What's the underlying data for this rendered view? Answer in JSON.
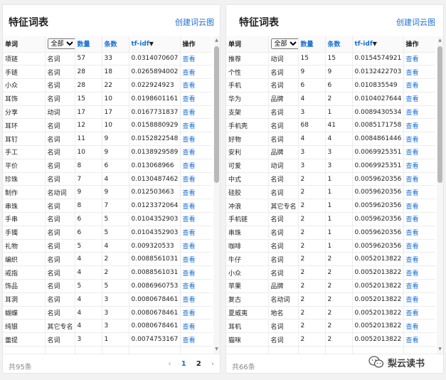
{
  "left_panel": {
    "title": "特征词表",
    "create_link": "创建词云图",
    "headers": {
      "word": "单词",
      "pos_filter": "全部",
      "count": "数量",
      "num": "条数",
      "tfidf": "tf-idf",
      "op": "操作"
    },
    "pos_options": [
      "全部"
    ],
    "rows": [
      [
        "项链",
        "名词",
        "57",
        "33",
        "0.0314070607",
        "查看"
      ],
      [
        "手链",
        "名词",
        "28",
        "18",
        "0.0265894002",
        "查看"
      ],
      [
        "小众",
        "名词",
        "28",
        "22",
        "0.022924923",
        "查看"
      ],
      [
        "耳饰",
        "名词",
        "15",
        "10",
        "0.0198601161",
        "查看"
      ],
      [
        "分享",
        "动词",
        "17",
        "17",
        "0.0167731837",
        "查看"
      ],
      [
        "耳环",
        "名词",
        "12",
        "10",
        "0.0158880929",
        "查看"
      ],
      [
        "耳钉",
        "名词",
        "11",
        "9",
        "0.0152822548",
        "查看"
      ],
      [
        "手工",
        "名词",
        "10",
        "9",
        "0.0138929589",
        "查看"
      ],
      [
        "平价",
        "名词",
        "8",
        "6",
        "0.013068966",
        "查看"
      ],
      [
        "珍珠",
        "名词",
        "7",
        "4",
        "0.0130487462",
        "查看"
      ],
      [
        "制作",
        "名动词",
        "9",
        "9",
        "0.012503663",
        "查看"
      ],
      [
        "串珠",
        "名词",
        "8",
        "7",
        "0.0123372064",
        "查看"
      ],
      [
        "手串",
        "名词",
        "6",
        "5",
        "0.0104352903",
        "查看"
      ],
      [
        "手镯",
        "名词",
        "6",
        "5",
        "0.0104352903",
        "查看"
      ],
      [
        "礼物",
        "名词",
        "5",
        "4",
        "0.009320533",
        "查看"
      ],
      [
        "编织",
        "名词",
        "4",
        "2",
        "0.0088561031",
        "查看"
      ],
      [
        "戒指",
        "名词",
        "4",
        "2",
        "0.0088561031",
        "查看"
      ],
      [
        "饰品",
        "名词",
        "5",
        "5",
        "0.0086960753",
        "查看"
      ],
      [
        "耳洞",
        "名词",
        "4",
        "3",
        "0.0080678461",
        "查看"
      ],
      [
        "蝴蝶",
        "名词",
        "4",
        "3",
        "0.0080678461",
        "查看"
      ],
      [
        "纯银",
        "其它专名",
        "4",
        "3",
        "0.0080678461",
        "查看"
      ],
      [
        "蕾提",
        "名词",
        "3",
        "1",
        "0.0074753167",
        "查看"
      ],
      [
        "",
        "",
        "",
        "",
        "",
        ""
      ]
    ],
    "total": "共95条",
    "pager": {
      "prev": "‹",
      "pages": [
        "1",
        "2"
      ],
      "next": "›"
    }
  },
  "right_panel": {
    "title": "特征词表",
    "create_link": "创建词云图",
    "headers": {
      "word": "单词",
      "pos_filter": "全部",
      "count": "数量",
      "num": "条数",
      "tfidf": "tf-idf",
      "op": "操作"
    },
    "pos_options": [
      "全部"
    ],
    "rows": [
      [
        "推荐",
        "动词",
        "15",
        "15",
        "0.0154574921",
        "查看"
      ],
      [
        "个性",
        "名词",
        "9",
        "9",
        "0.0132422703",
        "查看"
      ],
      [
        "手机",
        "名词",
        "6",
        "6",
        "0.010835549",
        "查看"
      ],
      [
        "华为",
        "品牌",
        "4",
        "2",
        "0.0104027644",
        "查看"
      ],
      [
        "支架",
        "名词",
        "3",
        "1",
        "0.0089430534",
        "查看"
      ],
      [
        "手机壳",
        "名词",
        "68",
        "41",
        "0.0085171758",
        "查看"
      ],
      [
        "好物",
        "名词",
        "4",
        "4",
        "0.0084861446",
        "查看"
      ],
      [
        "安利",
        "品牌",
        "3",
        "3",
        "0.0069925351",
        "查看"
      ],
      [
        "可爱",
        "动词",
        "3",
        "3",
        "0.0069925351",
        "查看"
      ],
      [
        "中式",
        "名词",
        "2",
        "1",
        "0.0059620356",
        "查看"
      ],
      [
        "硅胶",
        "名词",
        "2",
        "1",
        "0.0059620356",
        "查看"
      ],
      [
        "冲浪",
        "其它专名",
        "2",
        "1",
        "0.0059620356",
        "查看"
      ],
      [
        "手机链",
        "名词",
        "2",
        "1",
        "0.0059620356",
        "查看"
      ],
      [
        "串珠",
        "名词",
        "2",
        "1",
        "0.0059620356",
        "查看"
      ],
      [
        "咖啡",
        "名词",
        "2",
        "1",
        "0.0059620356",
        "查看"
      ],
      [
        "牛仔",
        "名词",
        "2",
        "2",
        "0.0052013822",
        "查看"
      ],
      [
        "小众",
        "名词",
        "2",
        "2",
        "0.0052013822",
        "查看"
      ],
      [
        "苹果",
        "品牌",
        "2",
        "2",
        "0.0052013822",
        "查看"
      ],
      [
        "复古",
        "名动词",
        "2",
        "2",
        "0.0052013822",
        "查看"
      ],
      [
        "夏威夷",
        "地名",
        "2",
        "2",
        "0.0052013822",
        "查看"
      ],
      [
        "耳机",
        "名词",
        "2",
        "2",
        "0.0052013822",
        "查看"
      ],
      [
        "猫咪",
        "名词",
        "2",
        "2",
        "0.0052013822",
        "查看"
      ],
      [
        "",
        "",
        "",
        "",
        "",
        ""
      ]
    ],
    "total": "共66条"
  },
  "scrollbar": {
    "up": "▲",
    "down": "▼"
  },
  "watermark": {
    "text": "梨云读书",
    "icon": "wechat-icon"
  },
  "colors": {
    "link": "#1a6fd6",
    "border": "#ececec",
    "background": "#f2f2f2"
  }
}
